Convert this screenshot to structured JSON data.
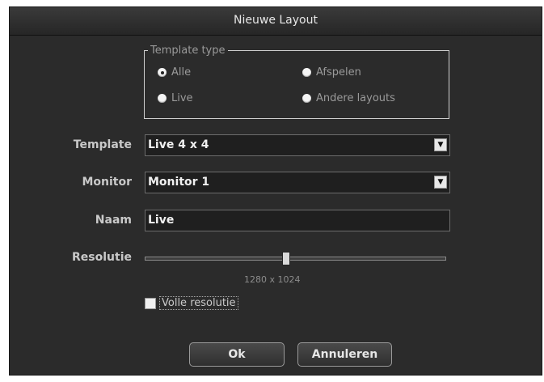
{
  "dialog": {
    "title": "Nieuwe Layout"
  },
  "template_type": {
    "legend": "Template type",
    "options": [
      {
        "label": "Alle",
        "checked": true
      },
      {
        "label": "Afspelen",
        "checked": false
      },
      {
        "label": "Live",
        "checked": false
      },
      {
        "label": "Andere layouts",
        "checked": false
      }
    ]
  },
  "fields": {
    "template_label": "Template",
    "template_value": "Live 4 x 4",
    "monitor_label": "Monitor",
    "monitor_value": "Monitor 1",
    "name_label": "Naam",
    "name_value": "Live",
    "resolution_label": "Resolutie",
    "resolution_value": "1280 x 1024",
    "resolution_level": 0.48,
    "full_resolution_label": "Volle resolutie",
    "full_resolution_checked": false
  },
  "buttons": {
    "ok": "Ok",
    "cancel": "Annuleren"
  },
  "icons": {
    "dropdown": "chevron-down-icon"
  }
}
